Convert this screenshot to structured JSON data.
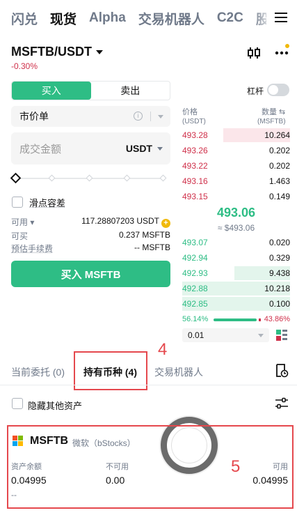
{
  "nav": {
    "tabs": [
      "闪兑",
      "现货",
      "Alpha",
      "交易机器人",
      "C2C",
      "股"
    ],
    "active_index": 1
  },
  "pair": {
    "symbol": "MSFTB/USDT",
    "change": "-0.30%"
  },
  "trade": {
    "buy_label": "买入",
    "sell_label": "卖出",
    "order_type": "市价单",
    "amount_placeholder": "成交金额",
    "amount_unit": "USDT",
    "slider_percent": 0,
    "slippage_label": "滑点容差",
    "available_label": "可用",
    "available_value": "117.28807203 USDT",
    "can_buy_label": "可买",
    "can_buy_value": "0.237 MSFTB",
    "fee_label": "预估手续费",
    "fee_value": "-- MSFTB",
    "submit_label": "买入 MSFTB"
  },
  "orderbook": {
    "leverage_label": "杠杆",
    "price_header": "价格",
    "price_unit": "(USDT)",
    "qty_header": "数量",
    "qty_unit": "(MSFTB)",
    "asks": [
      {
        "price": "493.28",
        "qty": "10.264",
        "depth": 0.62
      },
      {
        "price": "493.26",
        "qty": "0.202",
        "depth": 0
      },
      {
        "price": "493.22",
        "qty": "0.202",
        "depth": 0
      },
      {
        "price": "493.16",
        "qty": "1.463",
        "depth": 0
      },
      {
        "price": "493.15",
        "qty": "0.149",
        "depth": 0
      }
    ],
    "last_price": "493.06",
    "last_price_usd": "≈ $493.06",
    "bids": [
      {
        "price": "493.07",
        "qty": "0.020",
        "depth": 0
      },
      {
        "price": "492.94",
        "qty": "0.329",
        "depth": 0
      },
      {
        "price": "492.93",
        "qty": "9.438",
        "depth": 0.52
      },
      {
        "price": "492.88",
        "qty": "10.218",
        "depth": 1.0
      },
      {
        "price": "492.85",
        "qty": "0.100",
        "depth": 1.0
      }
    ],
    "bid_ratio": "56.14%",
    "ask_ratio": "43.86%",
    "precision": "0.01"
  },
  "bottom_tabs": {
    "open_orders": "当前委托 (0)",
    "holdings": "持有币种 (4)",
    "bots": "交易机器人"
  },
  "annotations": {
    "box_4": "4",
    "box_5": "5"
  },
  "holdings": {
    "hide_others_label": "隐藏其他资产",
    "asset": {
      "symbol": "MSFTB",
      "name": "微软（bStocks）",
      "balance_label": "资产余额",
      "balance_value": "0.04995",
      "unavailable_label": "不可用",
      "unavailable_value": "0.00",
      "available_label": "可用",
      "available_value": "0.04995",
      "extra": "--"
    }
  }
}
